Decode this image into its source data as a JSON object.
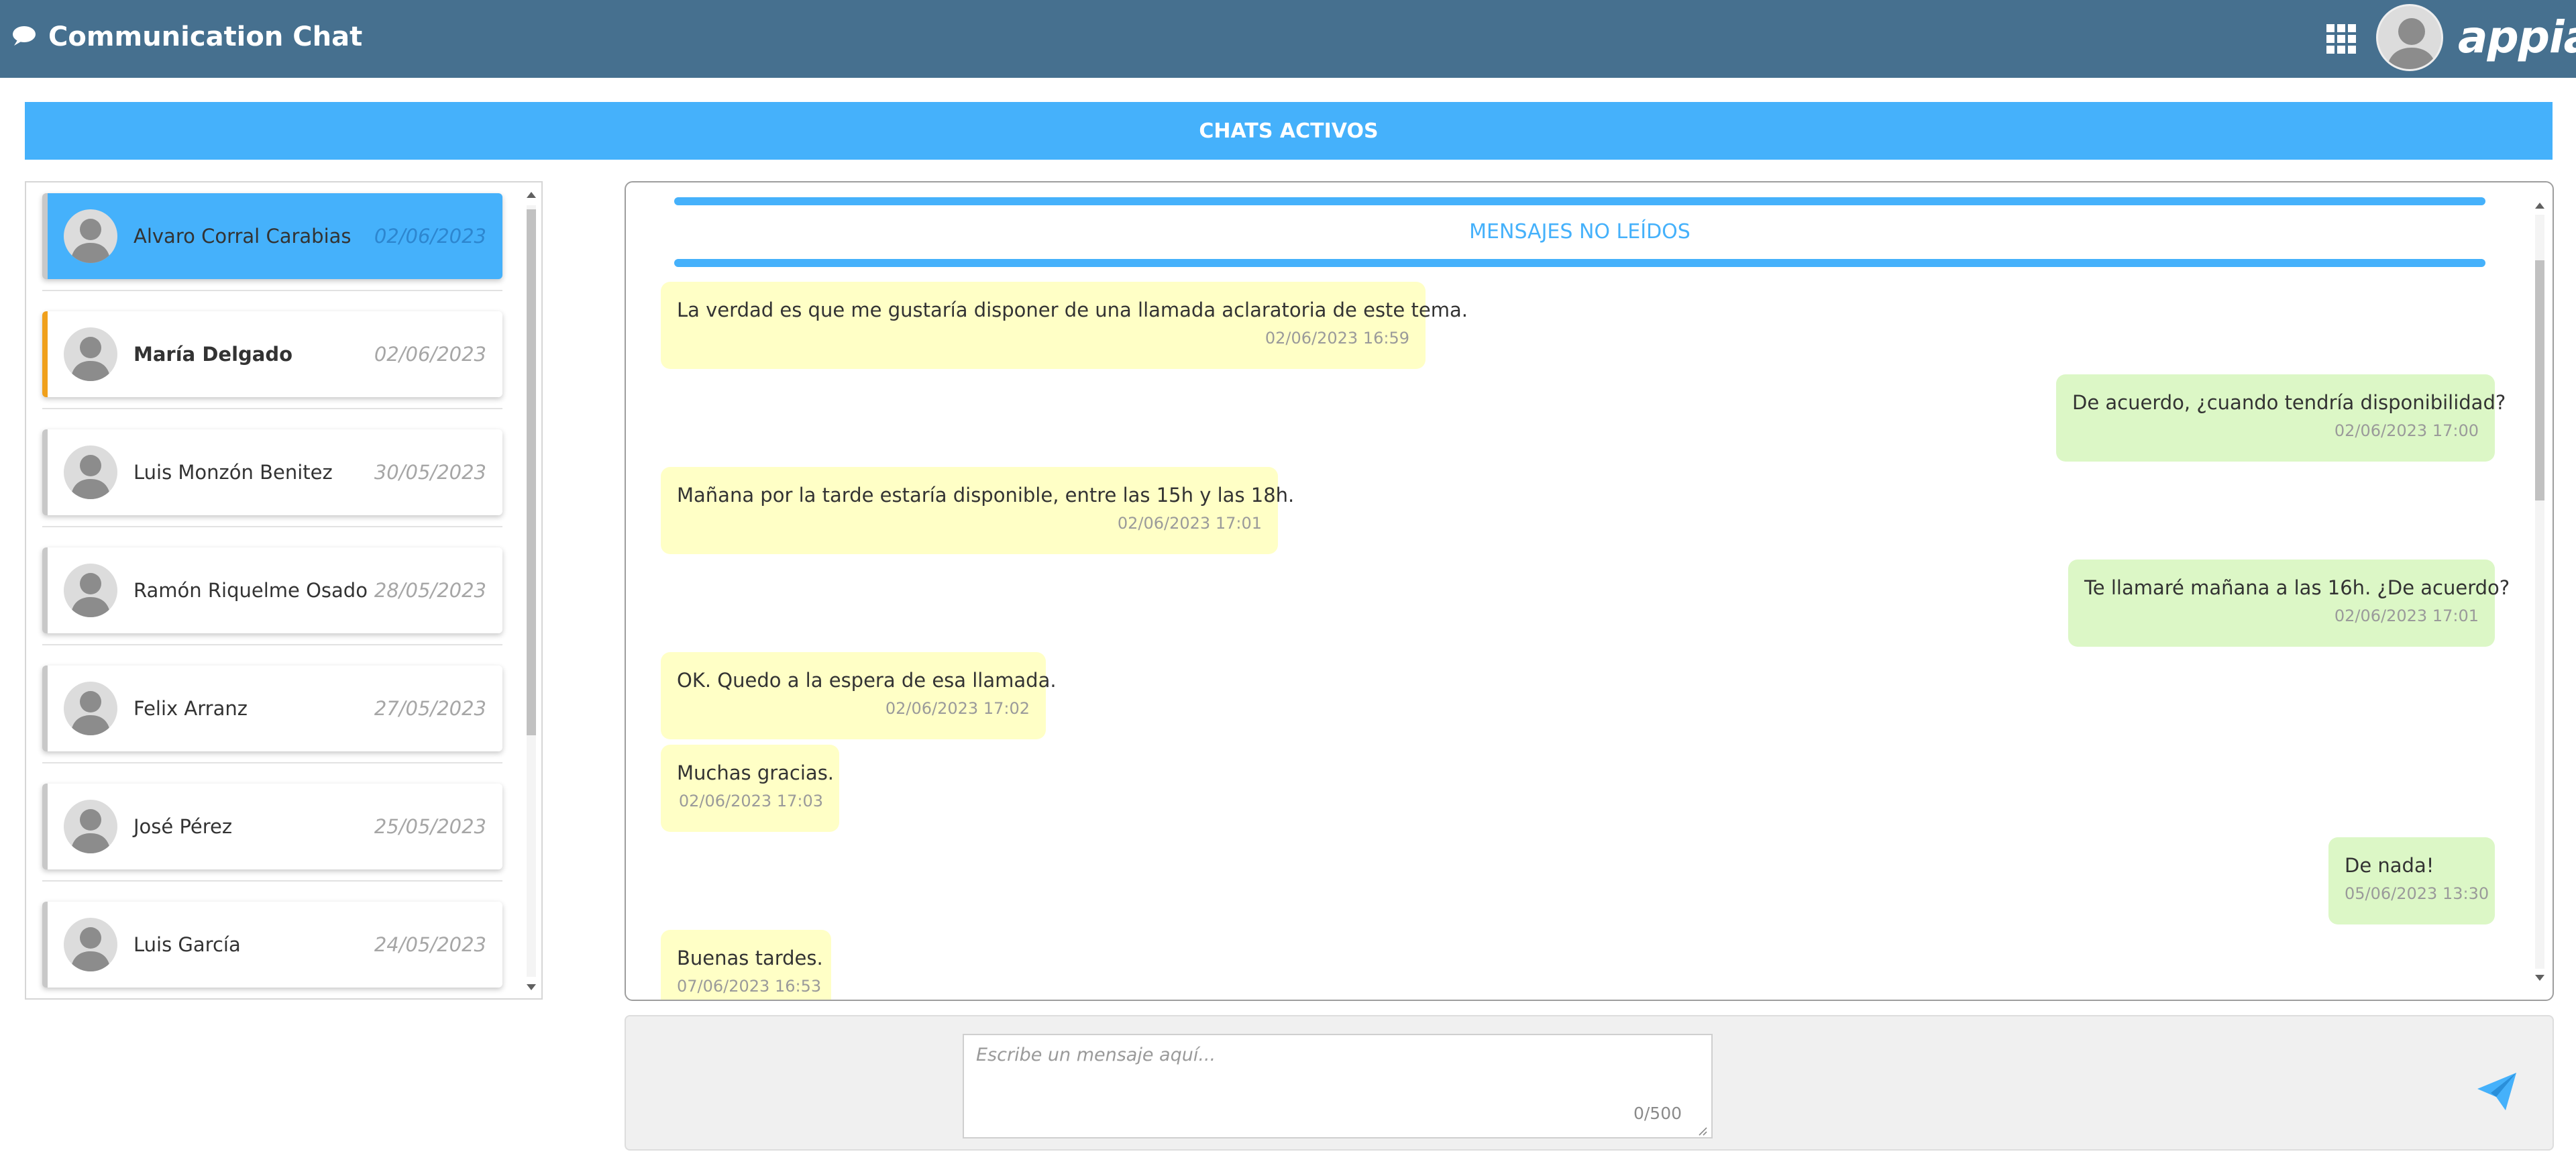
{
  "header": {
    "title": "Communication Chat",
    "brand": "appian",
    "icons": [
      "chat-bubble-icon",
      "app-grid-icon",
      "user-avatar"
    ]
  },
  "banner": {
    "title": "CHATS ACTIVOS"
  },
  "contacts": [
    {
      "name": "Alvaro Corral Carabias",
      "date": "02/06/2023",
      "state": "selected"
    },
    {
      "name": "María Delgado",
      "date": "02/06/2023",
      "state": "unread"
    },
    {
      "name": "Luis Monzón Benitez",
      "date": "30/05/2023",
      "state": "normal"
    },
    {
      "name": "Ramón Riquelme Osado",
      "date": "28/05/2023",
      "state": "normal"
    },
    {
      "name": "Felix Arranz",
      "date": "27/05/2023",
      "state": "normal"
    },
    {
      "name": "José Pérez",
      "date": "25/05/2023",
      "state": "normal"
    },
    {
      "name": "Luis García",
      "date": "24/05/2023",
      "state": "normal"
    }
  ],
  "conversation": {
    "unread_label": "MENSAJES NO LEÍDOS",
    "messages": [
      {
        "direction": "in",
        "text": "La verdad es que me gustaría disponer de una llamada aclaratoria de este tema.",
        "time": "02/06/2023 16:59"
      },
      {
        "direction": "out",
        "text": "De acuerdo, ¿cuando tendría disponibilidad?",
        "time": "02/06/2023 17:00"
      },
      {
        "direction": "in",
        "text": "Mañana por la tarde estaría disponible, entre las 15h y las 18h.",
        "time": "02/06/2023 17:01"
      },
      {
        "direction": "out",
        "text": "Te llamaré mañana a las 16h. ¿De acuerdo?",
        "time": "02/06/2023 17:01"
      },
      {
        "direction": "in",
        "text": "OK. Quedo a la espera de esa llamada.",
        "time": "02/06/2023 17:02"
      },
      {
        "direction": "in",
        "text": "Muchas gracias.",
        "time": "02/06/2023 17:03"
      },
      {
        "direction": "out",
        "text": "De nada!",
        "time": "05/06/2023 13:30"
      },
      {
        "direction": "in",
        "text": "Buenas tardes.",
        "time": "07/06/2023 16:53"
      }
    ]
  },
  "composer": {
    "placeholder": "Escribe un mensaje aquí...",
    "counter": "0/500"
  },
  "colors": {
    "header_bg": "#46708f",
    "accent": "#45b1fb",
    "unread_marker": "#f0a01c",
    "incoming_bubble": "#ffffc6",
    "outgoing_bubble": "#dcf7c6"
  }
}
